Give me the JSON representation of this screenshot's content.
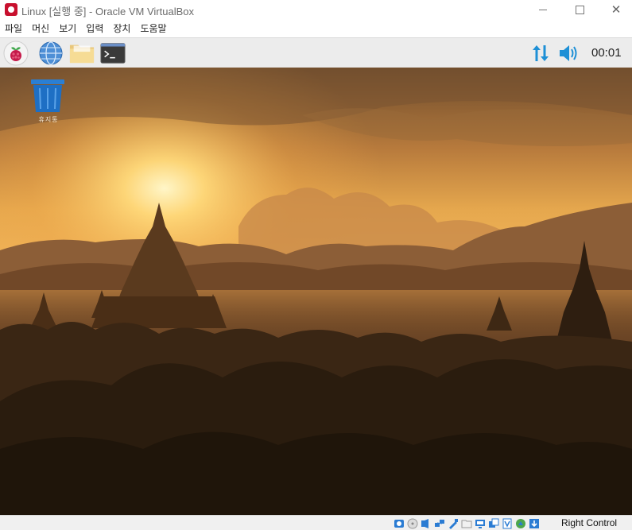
{
  "window": {
    "title": "Linux [실행 중] - Oracle VM VirtualBox",
    "controls": {
      "minimize": "minimize",
      "maximize": "maximize",
      "close": "close"
    }
  },
  "menubar": {
    "items": [
      {
        "label": "파일"
      },
      {
        "label": "머신"
      },
      {
        "label": "보기"
      },
      {
        "label": "입력"
      },
      {
        "label": "장치"
      },
      {
        "label": "도움말"
      }
    ]
  },
  "panel": {
    "launchers": [
      {
        "icon": "raspberry-pi-icon"
      },
      {
        "icon": "web-browser-icon"
      },
      {
        "icon": "file-manager-icon"
      },
      {
        "icon": "terminal-icon"
      }
    ],
    "tray": {
      "network_icon": "network-transfer-icon",
      "volume_icon": "volume-icon",
      "clock": "00:01"
    }
  },
  "desktop": {
    "wallpaper": "Sunset over temples of Bagan",
    "icons": [
      {
        "icon": "trash-icon",
        "label": "휴지통"
      }
    ]
  },
  "statusbar": {
    "icons": [
      "hard-disk-icon",
      "optical-drive-icon",
      "audio-icon",
      "network-icon",
      "usb-icon",
      "shared-folders-icon",
      "display-icon",
      "video-capture-icon",
      "virtualization-icon",
      "mouse-integration-icon",
      "keyboard-icon"
    ],
    "host_key": "Right Control"
  },
  "colors": {
    "accent_blue": "#1e90d6",
    "titlebar_bg": "#ffffff",
    "panel_bg": "#ececec",
    "statusbar_bg": "#f0f0f0"
  }
}
